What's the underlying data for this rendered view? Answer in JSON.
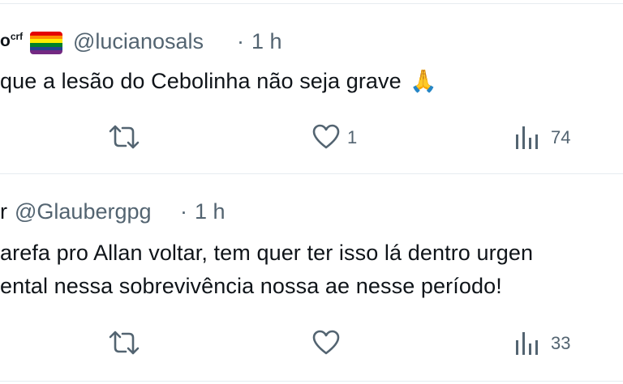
{
  "tweets": [
    {
      "name_fragment": "o",
      "name_sup": "crf",
      "handle": "@lucianosals",
      "dot": "·",
      "time": "1 h",
      "text": "que a lesão do Cebolinha não seja grave",
      "emoji": "🙏",
      "likes": "1",
      "views": "74"
    },
    {
      "name_fragment": "r",
      "handle": "@Glaubergpg",
      "dot": "·",
      "time": "1 h",
      "text_line1": "arefa pro Allan voltar, tem quer ter isso lá dentro urgen",
      "text_line2": "ental nessa sobrevivência nossa ae nesse período!",
      "likes": "",
      "views": "33"
    }
  ],
  "icons": {
    "retweet": "retweet-icon",
    "like": "heart-icon",
    "views": "analytics-icon",
    "flag": "rainbow-flag-icon"
  },
  "colors": {
    "text": "#0f1419",
    "muted": "#536471",
    "divider": "#e6ecf0"
  }
}
